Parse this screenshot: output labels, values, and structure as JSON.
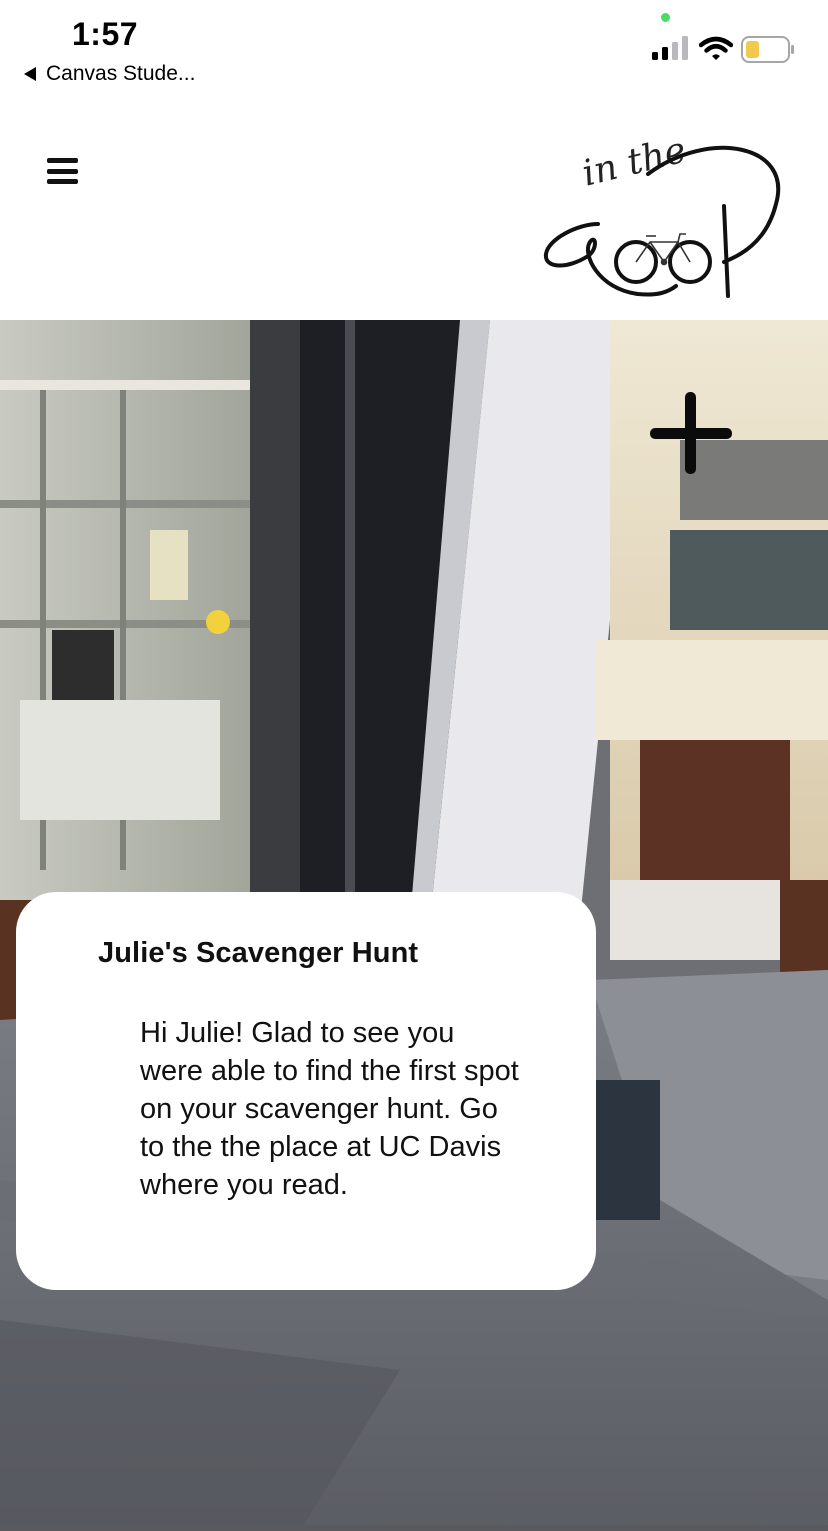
{
  "status_bar": {
    "time": "1:57",
    "back_label": "Canvas Stude...",
    "battery_color": "#f2c94c",
    "location_dot_color": "#4cd964"
  },
  "header": {
    "menu_icon": "hamburger-menu-icon",
    "logo_script": "in the",
    "logo_word": "Loop",
    "logo_icon": "bicycle-icon"
  },
  "camera": {
    "add_icon": "plus-icon"
  },
  "card": {
    "title": "Julie's Scavenger Hunt",
    "body": "Hi Julie! Glad to see you were able to find the first spot on your scavenger hunt. Go to the the place at UC Davis where you read."
  }
}
